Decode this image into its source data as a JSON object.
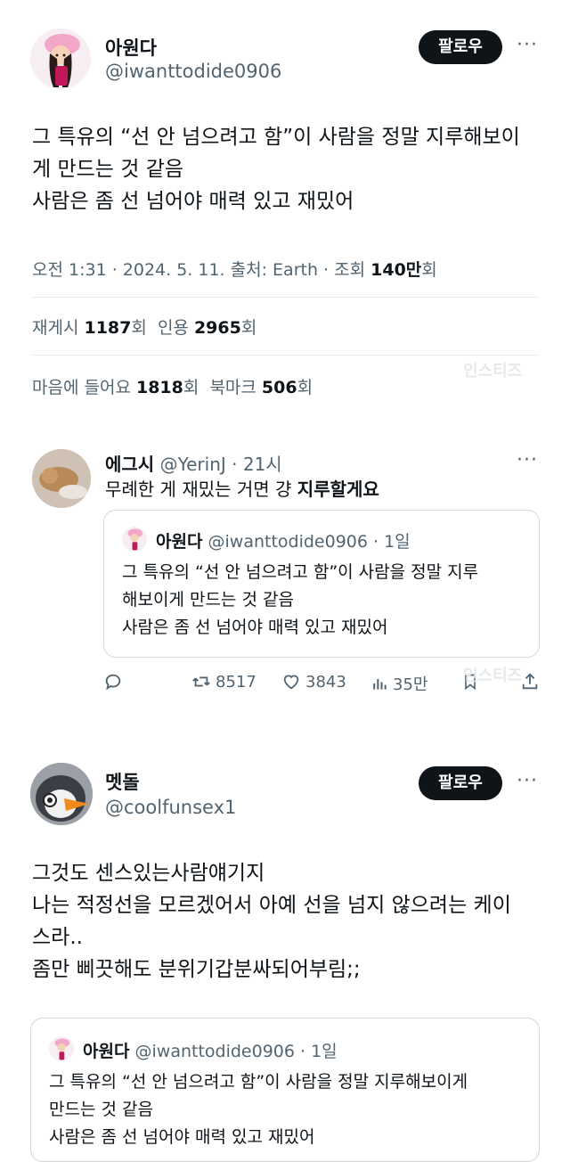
{
  "post1": {
    "name": "아원다",
    "handle": "@iwanttodide0906",
    "follow_label": "팔로우",
    "more": "···",
    "lines": [
      "그 특유의 “선 안 넘으려고 함”이 사람을 정말 지루해보이",
      "게 만드는 것 같음",
      "사람은 좀 선 넘어야 매력 있고 재밌어"
    ],
    "meta": {
      "time_prefix": "오전 1:31 · 2024. 5. 11. 출처: Earth · 조회 ",
      "views": "140만",
      "views_suffix": "회"
    },
    "stats1": {
      "repost_label": "재게시 ",
      "repost_count": "1187",
      "repost_suffix": "회",
      "quote_label": "인용 ",
      "quote_count": "2965",
      "quote_suffix": "회"
    },
    "stats2": {
      "like_label": "마음에 들어요 ",
      "like_count": "1818",
      "like_suffix": "회",
      "bookmark_label": "북마크 ",
      "bookmark_count": "506",
      "bookmark_suffix": "회"
    },
    "watermark": "인스티즈"
  },
  "reply1": {
    "name": "에그시",
    "handle_time": "@YerinJ · 21시",
    "more": "···",
    "text_prefix": "무례한 게 재밌는 거면 걍 ",
    "text_bold": "지루할게요",
    "quote": {
      "name": "아원다",
      "handle_time": "@iwanttodide0906 · 1일",
      "lines": [
        "그 특유의 “선 안 넘으려고 함”이 사람을 정말 지루",
        "해보이게 만드는 것 같음",
        "사람은 좀 선 넘어야 매력 있고 재밌어"
      ]
    },
    "actions": {
      "retweets": "8517",
      "likes": "3843",
      "views": "35만"
    },
    "watermark": "인스티즈"
  },
  "post2": {
    "name": "멧돌",
    "handle": "@coolfunsex1",
    "follow_label": "팔로우",
    "more": "···",
    "lines": [
      "그것도 센스있는사람얘기지",
      "나는 적정선을 모르겠어서 아예 선을 넘지 않으려는 케이",
      "스라..",
      "좀만 삐끗해도 분위기갑분싸되어부림;;"
    ],
    "quote": {
      "name": "아원다",
      "handle_time": "@iwanttodide0906 · 1일",
      "lines": [
        "그 특유의 “선 안 넘으려고 함”이 사람을 정말 지루해보이게",
        "만드는 것 같음",
        "사람은 좀 선 넘어야 매력 있고 재밌어"
      ]
    }
  },
  "colors": {
    "text": "#0f1419",
    "muted": "#536471",
    "border": "#cfd9de",
    "follow_bg": "#0f1419"
  }
}
